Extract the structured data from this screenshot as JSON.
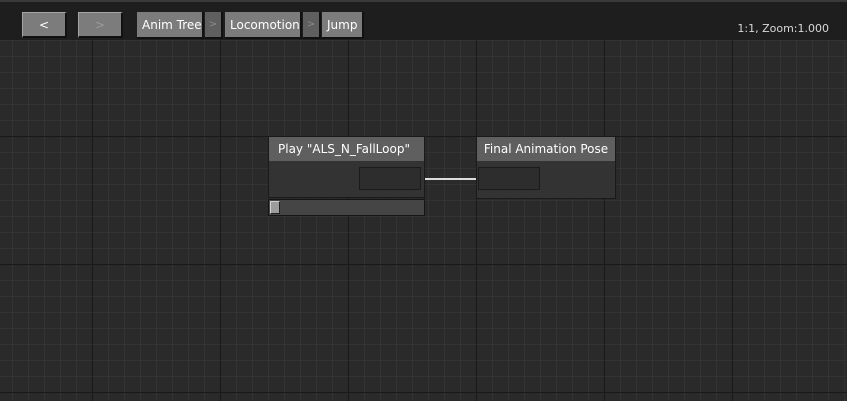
{
  "toolbar": {
    "back_label": "<",
    "forward_label": ">",
    "breadcrumbs": [
      "Anim Tree",
      "Locomotion",
      "Jump"
    ],
    "separator_label": ">",
    "zoom_text": "1:1, Zoom:1.000"
  },
  "nodes": {
    "play": {
      "title": "Play \"ALS_N_FallLoop\""
    },
    "final": {
      "title": "Final Animation Pose"
    }
  },
  "playback": {
    "progress": 0.0
  }
}
